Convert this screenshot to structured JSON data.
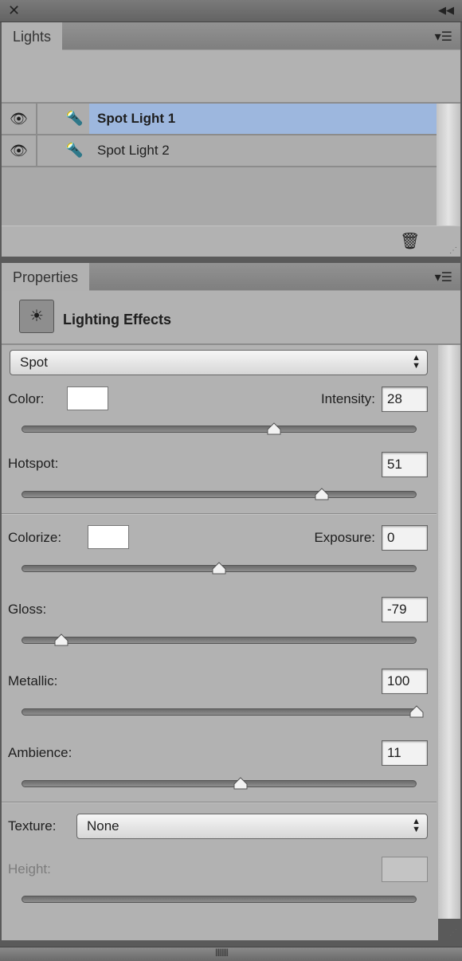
{
  "lights_panel": {
    "tab": "Lights",
    "items": [
      {
        "label": "Spot Light 1",
        "selected": true,
        "visible": true
      },
      {
        "label": "Spot Light 2",
        "selected": false,
        "visible": true
      }
    ]
  },
  "properties_panel": {
    "tab": "Properties",
    "title": "Lighting Effects",
    "light_type": "Spot",
    "color_label": "Color:",
    "color": "#ffffff",
    "intensity": {
      "label": "Intensity:",
      "value": "28",
      "fraction": 0.64
    },
    "hotspot": {
      "label": "Hotspot:",
      "value": "51",
      "fraction": 0.76
    },
    "colorize_label": "Colorize:",
    "colorize": "#ffffff",
    "exposure": {
      "label": "Exposure:",
      "value": "0",
      "fraction": 0.5
    },
    "gloss": {
      "label": "Gloss:",
      "value": "-79",
      "fraction": 0.1
    },
    "metallic": {
      "label": "Metallic:",
      "value": "100",
      "fraction": 1.0
    },
    "ambience": {
      "label": "Ambience:",
      "value": "11",
      "fraction": 0.555
    },
    "texture": {
      "label": "Texture:",
      "value": "None"
    },
    "height": {
      "label": "Height:",
      "value": "",
      "disabled": true
    }
  },
  "colors": {
    "selection": "#9db7de",
    "panel": "#b2b2b2"
  }
}
